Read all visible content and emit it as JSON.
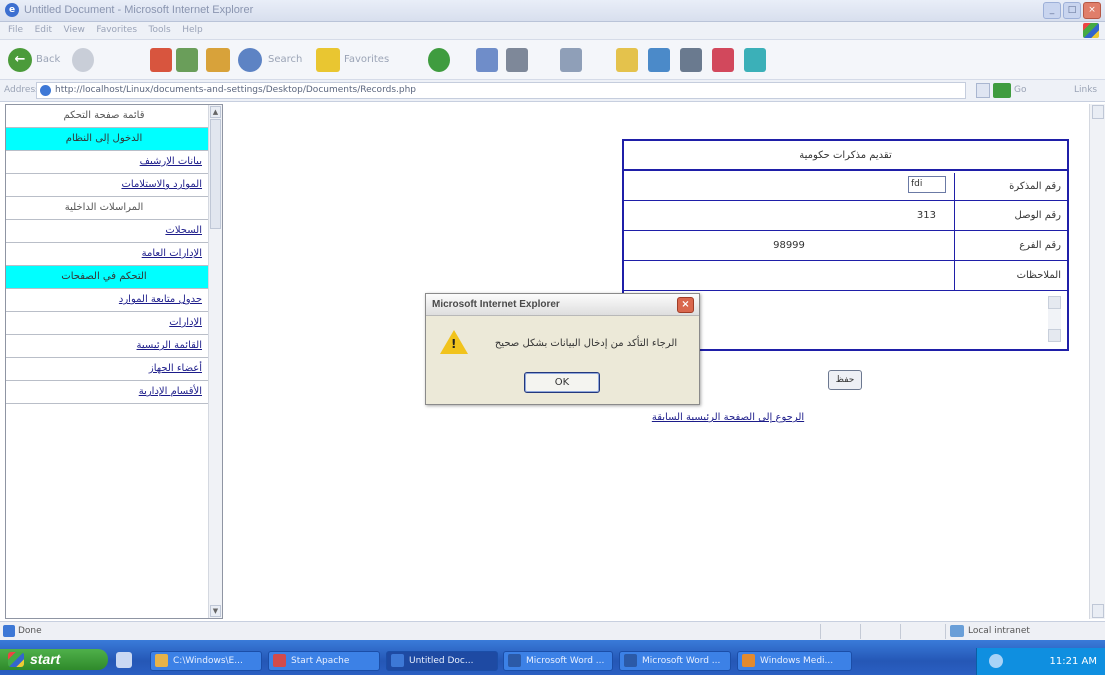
{
  "window": {
    "title": "Untitled Document - Microsoft Internet Explorer"
  },
  "menubar": {
    "items": [
      "File",
      "Edit",
      "View",
      "Favorites",
      "Tools",
      "Help"
    ]
  },
  "toolbar": {
    "back_label": "Back",
    "search_label": "Search",
    "favorites_label": "Favorites"
  },
  "addressbar": {
    "label": "Address",
    "url": "http://localhost/Linux/documents-and-settings/Desktop/Documents/Records.php",
    "go_label": "Go",
    "links_label": "Links"
  },
  "nav": {
    "items": [
      {
        "label": "قائمة صفحة التحكم",
        "kind": "plain"
      },
      {
        "label": "الدخول إلى النظام",
        "kind": "head"
      },
      {
        "label": "بيانات الإرشيف",
        "kind": "link"
      },
      {
        "label": "الموارد والاستلامات",
        "kind": "link"
      },
      {
        "label": "المراسلات الداخلية",
        "kind": "plain"
      },
      {
        "label": "السجلات",
        "kind": "link"
      },
      {
        "label": "الإدارات العامة",
        "kind": "link"
      },
      {
        "label": "التحكم في الصفحات",
        "kind": "head"
      },
      {
        "label": "جدول متابعة الموارد",
        "kind": "link"
      },
      {
        "label": "الإدارات",
        "kind": "link"
      },
      {
        "label": "القائمة الرئيسية",
        "kind": "link"
      },
      {
        "label": "أعضاء الجهاز",
        "kind": "link"
      },
      {
        "label": "الأقسام الإدارية",
        "kind": "link"
      }
    ]
  },
  "form": {
    "title": "تقديم مذكرات حكومية",
    "rows": [
      {
        "label": "رقم المذكرة",
        "value": "",
        "input_value": "fdi"
      },
      {
        "label": "رقم الوصل",
        "value": "313"
      },
      {
        "label": "رقم الفرع",
        "value": "98999"
      },
      {
        "label": "الملاحظات",
        "value": ""
      }
    ],
    "submit_label": "حفظ",
    "return_link": "الرجوع إلى الصفحة الرئيسية السابقة"
  },
  "dialog": {
    "title": "Microsoft Internet Explorer",
    "message": "الرجاء التأكد من إدخال البيانات بشكل صحيح",
    "ok_label": "OK",
    "close_label": "×"
  },
  "statusbar": {
    "text": "Done",
    "zone": "Local intranet"
  },
  "taskbar": {
    "start_label": "start",
    "tasks": [
      {
        "label": "C:\\Windows\\E...",
        "color": "#e6b34a",
        "active": false
      },
      {
        "label": "Start Apache",
        "color": "#d24b4b",
        "active": false
      },
      {
        "label": "Untitled Doc...",
        "color": "#3d78d6",
        "active": true
      },
      {
        "label": "Microsoft Word ...",
        "color": "#2b5aa8",
        "active": false
      },
      {
        "label": "Microsoft Word ...",
        "color": "#2b5aa8",
        "active": false
      },
      {
        "label": "Windows Medi...",
        "color": "#e28a2e",
        "active": false
      }
    ],
    "clock": "11:21 AM"
  },
  "colors": {
    "nav_heading": "#00ffff",
    "table_border": "#1f1fa8",
    "link": "#1c1c8a"
  }
}
